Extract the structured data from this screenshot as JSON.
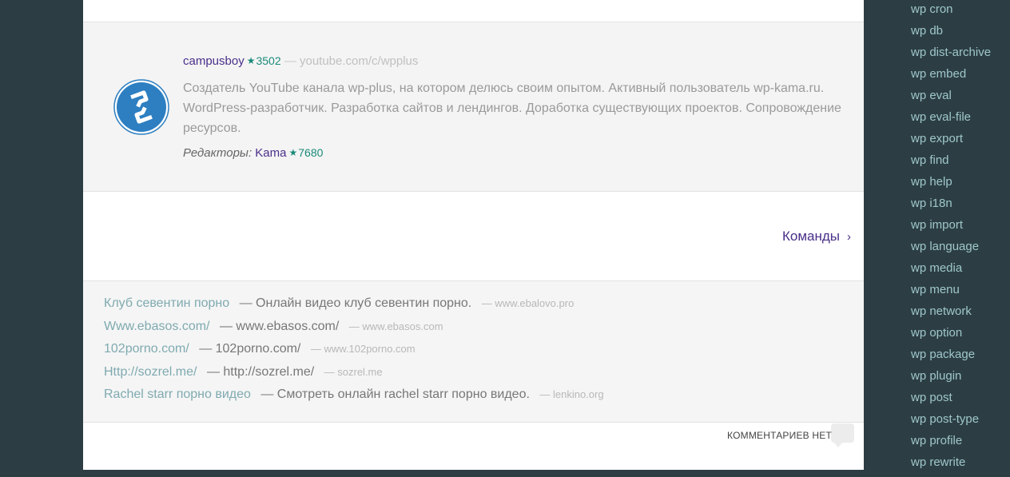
{
  "author": {
    "name": "campusboy",
    "rating": "3502",
    "separator": "—",
    "url": "youtube.com/c/wpplus",
    "description": "Создатель YouTube канала wp-plus, на котором делюсь своим опытом. Активный пользователь wp-kama.ru. WordPress-разработчик. Разработка сайтов и лендингов. Доработка существующих проектов. Сопровождение ресурсов.",
    "editors_label": "Редакторы:",
    "editor_name": "Kama",
    "editor_rating": "7680"
  },
  "navigation": {
    "next_label": "Команды",
    "chevron": "›"
  },
  "links": [
    {
      "anchor": "Клуб севентин порно",
      "desc": "— Онлайн видео клуб севентин порно.",
      "source": "— www.ebalovo.pro"
    },
    {
      "anchor": "Www.ebasos.com/",
      "desc": "— www.ebasos.com/",
      "source": "— www.ebasos.com"
    },
    {
      "anchor": "102porno.com/",
      "desc": "— 102porno.com/",
      "source": "— www.102porno.com"
    },
    {
      "anchor": "Http://sozrel.me/",
      "desc": "— http://sozrel.me/",
      "source": "— sozrel.me"
    },
    {
      "anchor": "Rachel starr порно видео",
      "desc": "— Смотреть онлайн rachel starr порно видео.",
      "source": "— lenkino.org"
    }
  ],
  "comments": {
    "label": "КОММЕНТАРИЕВ НЕТ",
    "icon": "comment-bubble-icon"
  },
  "sidebar": {
    "items": [
      "wp cron",
      "wp db",
      "wp dist-archive",
      "wp embed",
      "wp eval",
      "wp eval-file",
      "wp export",
      "wp find",
      "wp help",
      "wp i18n",
      "wp import",
      "wp language",
      "wp media",
      "wp menu",
      "wp network",
      "wp option",
      "wp package",
      "wp plugin",
      "wp post",
      "wp post-type",
      "wp profile",
      "wp rewrite"
    ]
  },
  "colors": {
    "page_bg": "#2c3e44",
    "link_purple": "#4a2f8a",
    "rating_teal": "#1a8a7a",
    "sidebar_link": "#9fc7cb",
    "avatar_blue": "#2d7fc1"
  }
}
